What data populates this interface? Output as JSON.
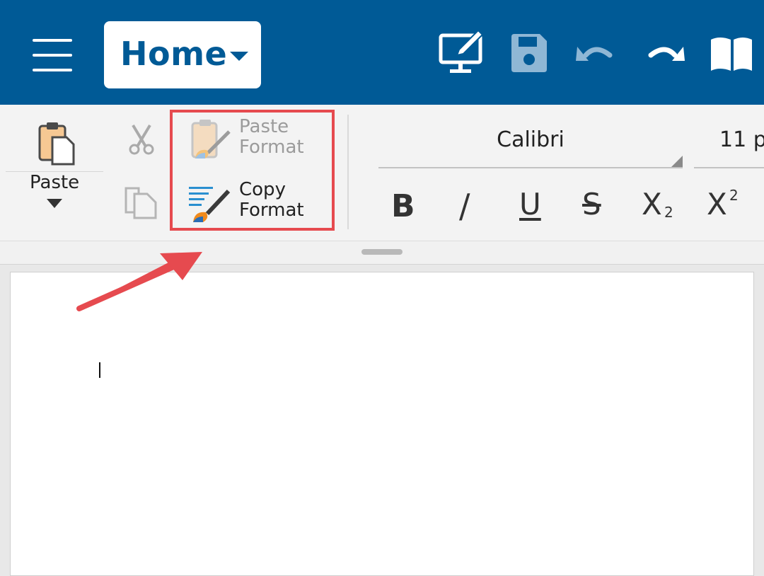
{
  "header": {
    "tab": {
      "label": "Home"
    },
    "icons": [
      "menu-icon",
      "tab-dropdown-caret-icon",
      "read-mode-icon",
      "save-icon",
      "undo-icon",
      "redo-icon",
      "book-icon"
    ]
  },
  "ribbon": {
    "clipboard": {
      "paste_label": "Paste",
      "cut_icon": "scissors-icon",
      "copy_icon": "copy-icon"
    },
    "format_painter": {
      "paste_format_line1": "Paste",
      "paste_format_line2": "Format",
      "copy_format_line1": "Copy",
      "copy_format_line2": "Format"
    },
    "font": {
      "name": "Calibri",
      "size": "11 p"
    },
    "format_buttons": {
      "bold": "B",
      "italic": "/",
      "underline": "U",
      "strikethrough": "S",
      "subscript_base": "X",
      "subscript_mark": "2",
      "superscript_base": "X",
      "superscript_mark": "2"
    }
  },
  "colors": {
    "appbar": "#005a96",
    "highlight": "#e64a4f",
    "ribbon": "#f3f3f3"
  }
}
